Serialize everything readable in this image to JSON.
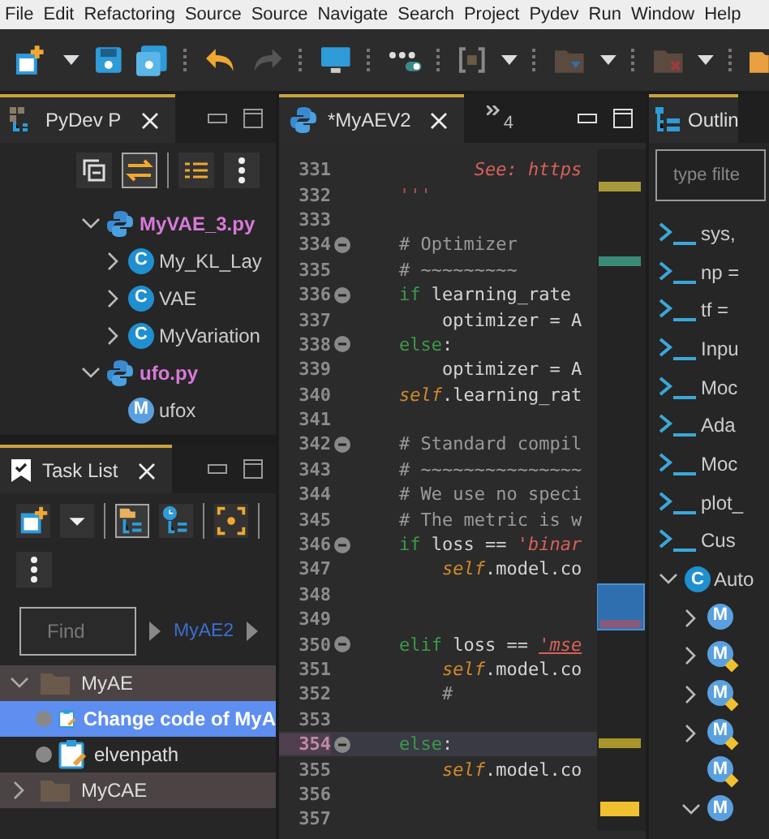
{
  "menu": [
    "File",
    "Edit",
    "Refactoring",
    "Source",
    "Source",
    "Navigate",
    "Search",
    "Project",
    "Pydev",
    "Run",
    "Window",
    "Help"
  ],
  "left_panel": {
    "tab": {
      "label": "PyDev P",
      "selected": true
    },
    "tree": [
      {
        "label": "MyVAE_3.py",
        "kind": "module",
        "expanded": true,
        "children": [
          {
            "label": "My_KL_Lay",
            "kind": "class",
            "icon": "C",
            "expanded": false
          },
          {
            "label": "VAE",
            "kind": "class",
            "icon": "C",
            "expanded": false
          },
          {
            "label": "MyVariation",
            "kind": "class",
            "icon": "C",
            "expanded": false
          }
        ]
      },
      {
        "label": "ufo.py",
        "kind": "module",
        "expanded": true,
        "children": [
          {
            "label": "ufox",
            "kind": "method",
            "icon": "M"
          }
        ]
      }
    ]
  },
  "editor": {
    "tab": {
      "label": "*MyAEV2",
      "selected": true
    },
    "overflow_count": "4",
    "lines": [
      {
        "number": "331",
        "fold": false,
        "current": false,
        "tokens": [
          {
            "text": "       See: https",
            "kind": "string"
          }
        ]
      },
      {
        "number": "332",
        "fold": false,
        "current": false,
        "tokens": [
          {
            "text": "'''",
            "kind": "docstring"
          }
        ]
      },
      {
        "number": "333",
        "fold": false,
        "current": false
      },
      {
        "number": "334",
        "fold": true,
        "current": false,
        "tokens": [
          {
            "text": "# Optimizer",
            "kind": "comment"
          }
        ]
      },
      {
        "number": "335",
        "fold": false,
        "current": false,
        "tokens": [
          {
            "text": "# ~~~~~~~~~",
            "kind": "comment"
          }
        ]
      },
      {
        "number": "336",
        "fold": true,
        "current": false,
        "tokens": [
          {
            "text": "if",
            "kind": "keyword"
          },
          {
            "text": " learning_rate",
            "kind": "plain"
          }
        ]
      },
      {
        "number": "337",
        "fold": false,
        "current": false,
        "tokens": [
          {
            "text": "    optimizer = A",
            "kind": "plain"
          }
        ]
      },
      {
        "number": "338",
        "fold": true,
        "current": false,
        "tokens": [
          {
            "text": "else",
            "kind": "keyword"
          },
          {
            "text": ":",
            "kind": "plain"
          }
        ]
      },
      {
        "number": "339",
        "fold": false,
        "current": false,
        "tokens": [
          {
            "text": "    optimizer = A",
            "kind": "plain"
          }
        ]
      },
      {
        "number": "340",
        "fold": false,
        "current": false,
        "tokens": [
          {
            "text": "self",
            "kind": "self"
          },
          {
            "text": ".learning_rat",
            "kind": "plain"
          }
        ]
      },
      {
        "number": "341",
        "fold": false,
        "current": false
      },
      {
        "number": "342",
        "fold": true,
        "current": false,
        "tokens": [
          {
            "text": "# Standard compil",
            "kind": "comment"
          }
        ]
      },
      {
        "number": "343",
        "fold": false,
        "current": false,
        "tokens": [
          {
            "text": "# ~~~~~~~~~~~~~~~",
            "kind": "comment"
          }
        ]
      },
      {
        "number": "344",
        "fold": false,
        "current": false,
        "tokens": [
          {
            "text": "# We use no speci",
            "kind": "comment"
          }
        ]
      },
      {
        "number": "345",
        "fold": false,
        "current": false,
        "tokens": [
          {
            "text": "# The metric is w",
            "kind": "comment"
          }
        ]
      },
      {
        "number": "346",
        "fold": true,
        "current": false,
        "tokens": [
          {
            "text": "if",
            "kind": "keyword"
          },
          {
            "text": " loss == ",
            "kind": "plain"
          },
          {
            "text": "'binar",
            "kind": "string"
          }
        ]
      },
      {
        "number": "347",
        "fold": false,
        "current": false,
        "tokens": [
          {
            "text": "    self",
            "kind": "self"
          },
          {
            "text": ".model.co",
            "kind": "plain"
          }
        ]
      },
      {
        "number": "348",
        "fold": false,
        "current": false
      },
      {
        "number": "349",
        "fold": false,
        "current": false
      },
      {
        "number": "350",
        "fold": true,
        "current": false,
        "tokens": [
          {
            "text": "elif",
            "kind": "keyword"
          },
          {
            "text": " loss == ",
            "kind": "plain"
          },
          {
            "text": "'mse",
            "kind": "error-string"
          }
        ]
      },
      {
        "number": "351",
        "fold": false,
        "current": false,
        "tokens": [
          {
            "text": "    self",
            "kind": "self"
          },
          {
            "text": ".model.co",
            "kind": "plain"
          }
        ]
      },
      {
        "number": "352",
        "fold": false,
        "current": false,
        "tokens": [
          {
            "text": "    #",
            "kind": "comment"
          }
        ]
      },
      {
        "number": "353",
        "fold": false,
        "current": false
      },
      {
        "number": "354",
        "fold": true,
        "current": true,
        "tokens": [
          {
            "text": "else",
            "kind": "keyword"
          },
          {
            "text": ":",
            "kind": "plain"
          }
        ]
      },
      {
        "number": "355",
        "fold": false,
        "current": false,
        "tokens": [
          {
            "text": "    self",
            "kind": "self"
          },
          {
            "text": ".model.co",
            "kind": "plain"
          }
        ]
      },
      {
        "number": "356",
        "fold": false,
        "current": false
      },
      {
        "number": "357",
        "fold": false,
        "current": false
      }
    ]
  },
  "task_list": {
    "tab": {
      "label": "Task List",
      "selected": true
    },
    "find": {
      "placeholder": "Find"
    },
    "breadcrumb": "MyAE2",
    "groups": [
      {
        "label": "MyAE",
        "expanded": true,
        "tasks": [
          {
            "label": "Change code of MyA",
            "selected": true
          },
          {
            "label": "elvenpath",
            "selected": false
          }
        ]
      },
      {
        "label": "MyCAE",
        "expanded": false
      }
    ]
  },
  "outline": {
    "tab": {
      "label": "Outlin",
      "selected": true
    },
    "filter": {
      "placeholder": "type filte"
    },
    "items": [
      {
        "label": "sys,",
        "kind": "import"
      },
      {
        "label": "np =",
        "kind": "import"
      },
      {
        "label": "tf =",
        "kind": "import"
      },
      {
        "label": "Inpu",
        "kind": "import"
      },
      {
        "label": "Moc",
        "kind": "import"
      },
      {
        "label": "Ada",
        "kind": "import"
      },
      {
        "label": "Moc",
        "kind": "import"
      },
      {
        "label": "plot_",
        "kind": "import"
      },
      {
        "label": "Cus",
        "kind": "import"
      },
      {
        "label": "Auto",
        "kind": "class",
        "icon": "C",
        "expanded": true,
        "children": [
          {
            "icon": "M",
            "expanded": false,
            "overridden": false
          },
          {
            "icon": "M",
            "expanded": false,
            "overridden": true
          },
          {
            "icon": "M",
            "expanded": false,
            "overridden": true
          },
          {
            "icon": "M",
            "expanded": false,
            "overridden": true
          },
          {
            "icon": "M",
            "overridden": true
          },
          {
            "icon": "M",
            "expanded": true,
            "overridden": false
          }
        ]
      }
    ]
  }
}
